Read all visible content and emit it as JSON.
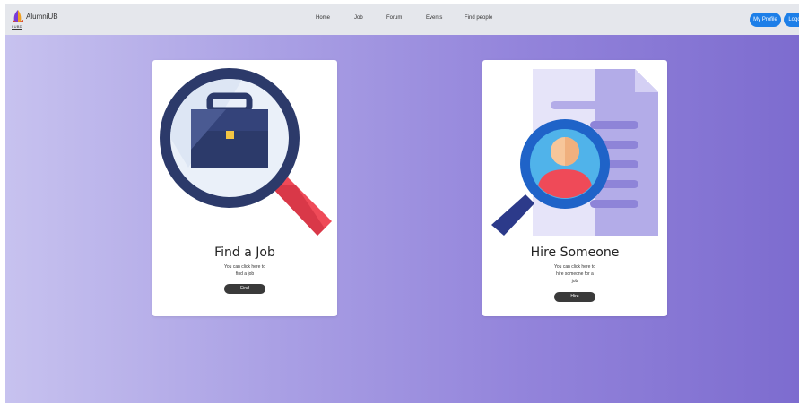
{
  "navbar": {
    "brand_name": "AlumniUB",
    "brand_sub": "IIUBD",
    "links": [
      "Home",
      "Job",
      "Forum",
      "Events",
      "Find people"
    ],
    "my_profile_label": "My Profile",
    "logout_label": "Logo"
  },
  "cards": {
    "find_job": {
      "title": "Find a Job",
      "desc_lines": [
        "You can click here to",
        "find a job"
      ],
      "button_label": "Find"
    },
    "hire": {
      "title": "Hire Someone",
      "desc_lines": [
        "You can click here to",
        "hire someone for a",
        "job"
      ],
      "button_label": "Hire"
    }
  },
  "colors": {
    "accent": "#1d7fe8",
    "dark_button": "#3a3a3a",
    "gradient_start": "#c7c2ef",
    "gradient_end": "#7d6ccf"
  }
}
